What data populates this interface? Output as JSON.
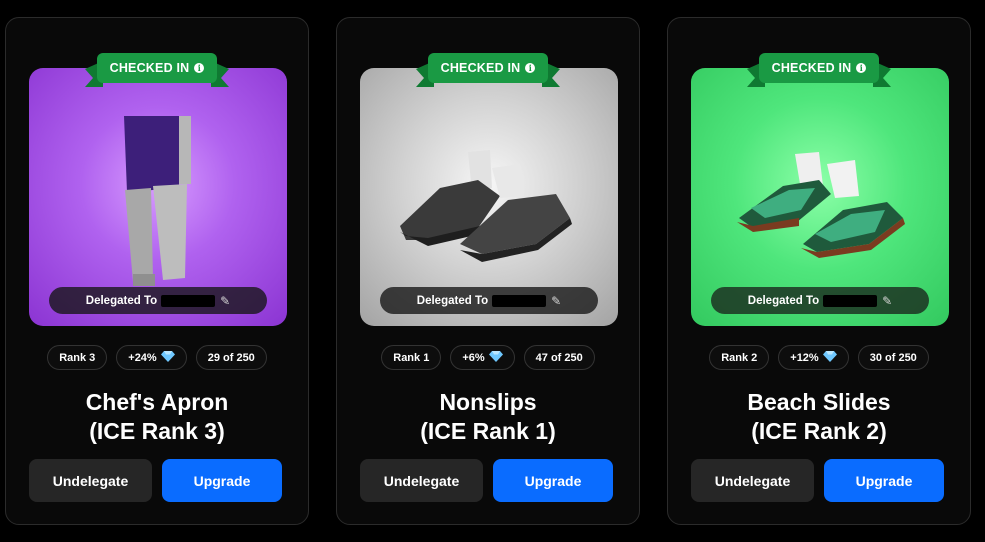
{
  "colors": {
    "background": "#000000",
    "card_border": "#2b2b2b",
    "banner_green": "#1a9a44",
    "upgrade_blue": "#0a6cff",
    "undelegate_gray": "#262626"
  },
  "cards": [
    {
      "banner": "CHECKED IN",
      "info_icon": "i",
      "art_color": "purple",
      "delegated_label": "Delegated To",
      "rank": "Rank 3",
      "bonus": "+24%",
      "bonus_icon": "diamond-icon",
      "count": "29 of 250",
      "title_line1": "Chef's Apron",
      "title_line2": "(ICE Rank 3)",
      "undelegate_label": "Undelegate",
      "upgrade_label": "Upgrade"
    },
    {
      "banner": "CHECKED IN",
      "info_icon": "i",
      "art_color": "gray",
      "delegated_label": "Delegated To",
      "rank": "Rank 1",
      "bonus": "+6%",
      "bonus_icon": "diamond-icon",
      "count": "47 of 250",
      "title_line1": "Nonslips",
      "title_line2": "(ICE Rank 1)",
      "undelegate_label": "Undelegate",
      "upgrade_label": "Upgrade"
    },
    {
      "banner": "CHECKED IN",
      "info_icon": "i",
      "art_color": "green",
      "delegated_label": "Delegated To",
      "rank": "Rank 2",
      "bonus": "+12%",
      "bonus_icon": "diamond-icon",
      "count": "30 of 250",
      "title_line1": "Beach Slides",
      "title_line2": "(ICE Rank 2)",
      "undelegate_label": "Undelegate",
      "upgrade_label": "Upgrade"
    }
  ]
}
